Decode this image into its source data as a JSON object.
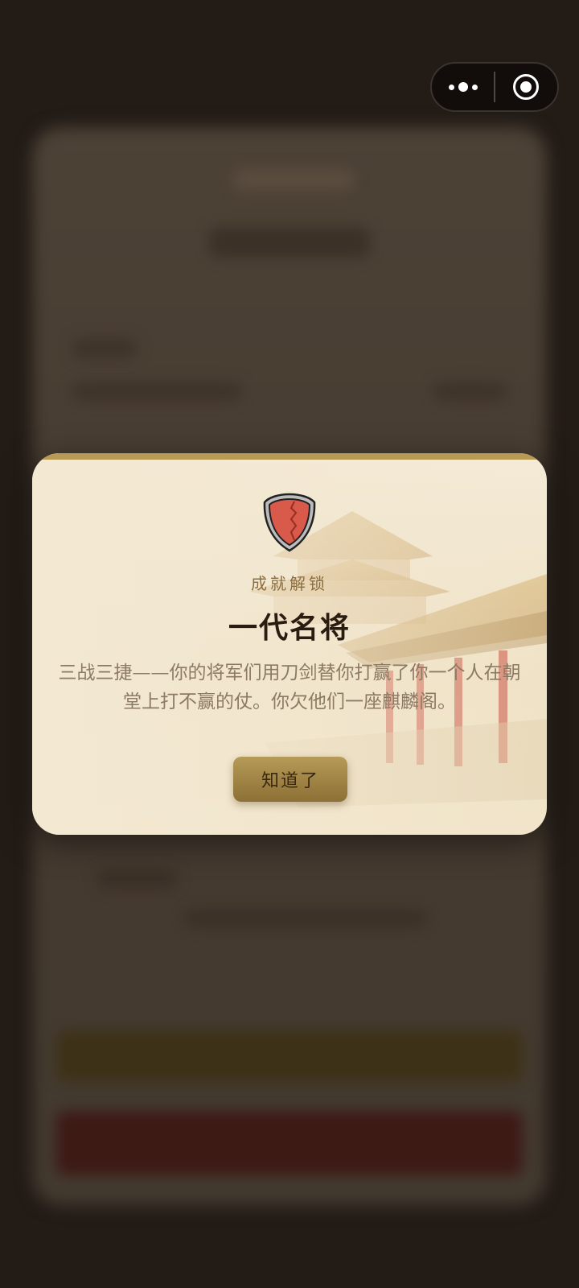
{
  "capsule": {
    "more_icon": "more-dots-icon",
    "close_icon": "target-close-icon"
  },
  "modal": {
    "badge_icon": "shield-icon",
    "subtitle": "成就解锁",
    "title": "一代名将",
    "description": "三战三捷——你的将军们用刀剑替你打赢了你一个人在朝堂上打不赢的仗。你欠他们一座麒麟阁。",
    "button_label": "知道了",
    "colors": {
      "accent_gold": "#b89a55",
      "shield_red": "#d95a4a",
      "title_text": "#2a1c10"
    }
  }
}
